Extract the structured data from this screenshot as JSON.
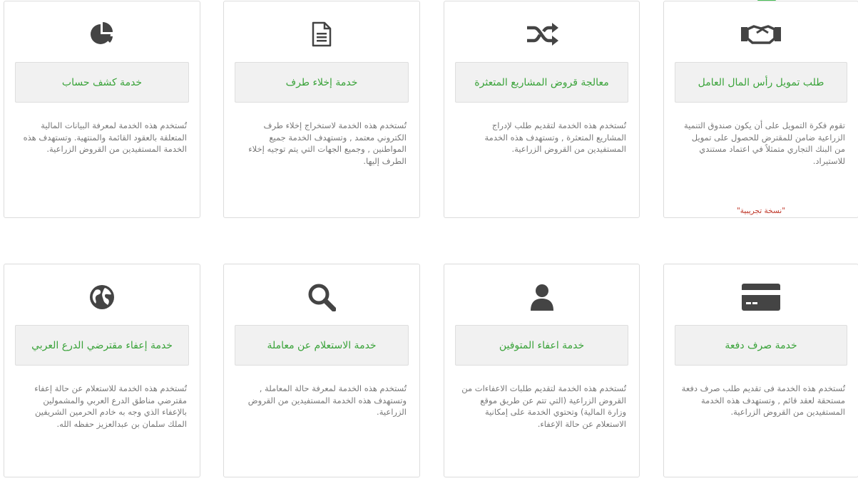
{
  "accent_color": "#3aa33a",
  "cards": [
    {
      "icon": "handshake-icon",
      "title": "طلب تمويل رأس المال العامل",
      "desc": "تقوم فكرة التمويل على أن يكون صندوق التنمية الزراعية ضامن للمقترض للحصول على تمويل من البنك التجاري متمثلاً في اعتماد مستندي للاستيراد.",
      "note": "\"نسخة تجريبية\""
    },
    {
      "icon": "shuffle-icon",
      "title": "معالجة قروض المشاريع المتعثرة",
      "desc": "تُستخدم هذه الخدمة لتقديم طلب لإدراج المشاريع المتعثرة , وتستهدف هذه الخدمة المستفيدين من القروض الزراعية."
    },
    {
      "icon": "document-icon",
      "title": "خدمة إخلاء طرف",
      "desc": "تُستخدم هذه الخدمة لاستخراج إخلاء طرف الكتروني معتمد , وتستهدف الخدمة جميع المواطنين , وجميع الجهات التي يتم توجيه إخلاء الطرف إليها."
    },
    {
      "icon": "pie-chart-icon",
      "title": "خدمة كشف حساب",
      "desc": "تُستخدم هذه الخدمة لمعرفة البيانات المالية المتعلقة بالعقود القائمة والمنتهية. وتستهدف هذه الخدمة المستفيدين من القروض الزراعية."
    },
    {
      "icon": "credit-card-icon",
      "title": "خدمة صرف دفعة",
      "desc": "تُستخدم هذه الخدمة فى تقديم طلب صرف دفعة مستحقة لعقد قائم , وتستهدف هذه الخدمة المستفيدين من القروض الزراعية."
    },
    {
      "icon": "user-icon",
      "title": "خدمة اعفاء المتوفين",
      "desc": "تُستخدم هذه الخدمة لتقديم طلبات الاعفاءات من القروض الزراعية (التي تتم عن طريق موقع وزارة المالية) وتحتوي الخدمة على إمكانية الاستعلام عن حالة الإعفاء."
    },
    {
      "icon": "search-icon",
      "title": "خدمة الاستعلام عن معاملة",
      "desc": "تُستخدم هذه الخدمة لمعرفة حالة المعاملة , وتستهدف هذه الخدمة المستفيدين من القروض الزراعية."
    },
    {
      "icon": "globe-icon",
      "title": "خدمة إعفاء مقترضي الدرع العربي",
      "desc": "تُستخدم هذه الخدمة للاستعلام عن حالة إعفاء مقترضي مناطق الدرع العربي والمشمولين بالإعفاء الذي وجه به خادم الحرمين الشريفين الملك سلمان بن عبدالعزيز حفظه الله."
    }
  ]
}
